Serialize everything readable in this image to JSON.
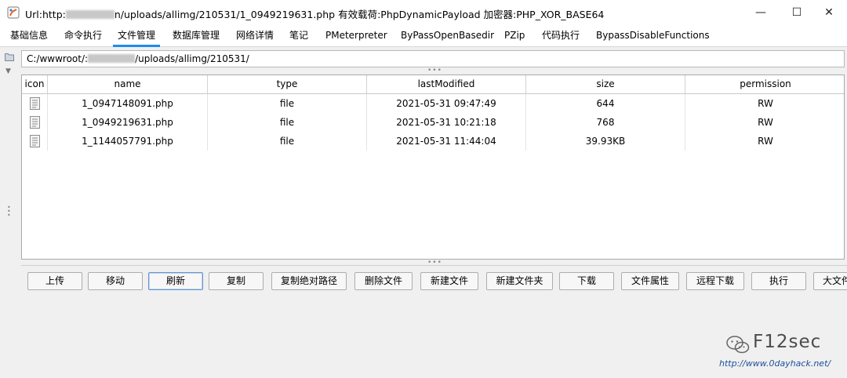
{
  "window": {
    "title_prefix": "Url:http:",
    "title_suffix": "n/uploads/allimg/210531/1_0949219631.php 有效载荷:PhpDynamicPayload 加密器:PHP_XOR_BASE64",
    "minimize": "—",
    "maximize": "☐",
    "close": "✕"
  },
  "menu": {
    "items": [
      "基础信息",
      "命令执行",
      "文件管理",
      "数据库管理",
      "网络详情",
      "笔记",
      "PMeterpreter",
      "ByPassOpenBasedir",
      "PZip",
      "代码执行",
      "BypassDisableFunctions"
    ],
    "active": "文件管理"
  },
  "path": {
    "prefix": "C:/wwwroot/:",
    "suffix": "/uploads/allimg/210531/"
  },
  "table": {
    "columns": [
      "icon",
      "name",
      "type",
      "lastModified",
      "size",
      "permission"
    ],
    "rows": [
      {
        "name": "1_0947148091.php",
        "type": "file",
        "lastModified": "2021-05-31 09:47:49",
        "size": "644",
        "permission": "RW"
      },
      {
        "name": "1_0949219631.php",
        "type": "file",
        "lastModified": "2021-05-31 10:21:18",
        "size": "768",
        "permission": "RW"
      },
      {
        "name": "1_1144057791.php",
        "type": "file",
        "lastModified": "2021-05-31 11:44:04",
        "size": "39.93KB",
        "permission": "RW"
      }
    ]
  },
  "buttons": [
    "上传",
    "移动",
    "刷新",
    "复制",
    "复制绝对路径",
    "删除文件",
    "新建文件",
    "新建文件夹",
    "下载",
    "文件属性",
    "远程下载",
    "执行",
    "大文件"
  ],
  "focused_button": "刷新",
  "watermark": {
    "title": "F12sec",
    "url": "http://www.0dayhack.net/"
  },
  "colors": {
    "accent": "#1f8ceb",
    "watermark_url": "#1a4f9c"
  }
}
